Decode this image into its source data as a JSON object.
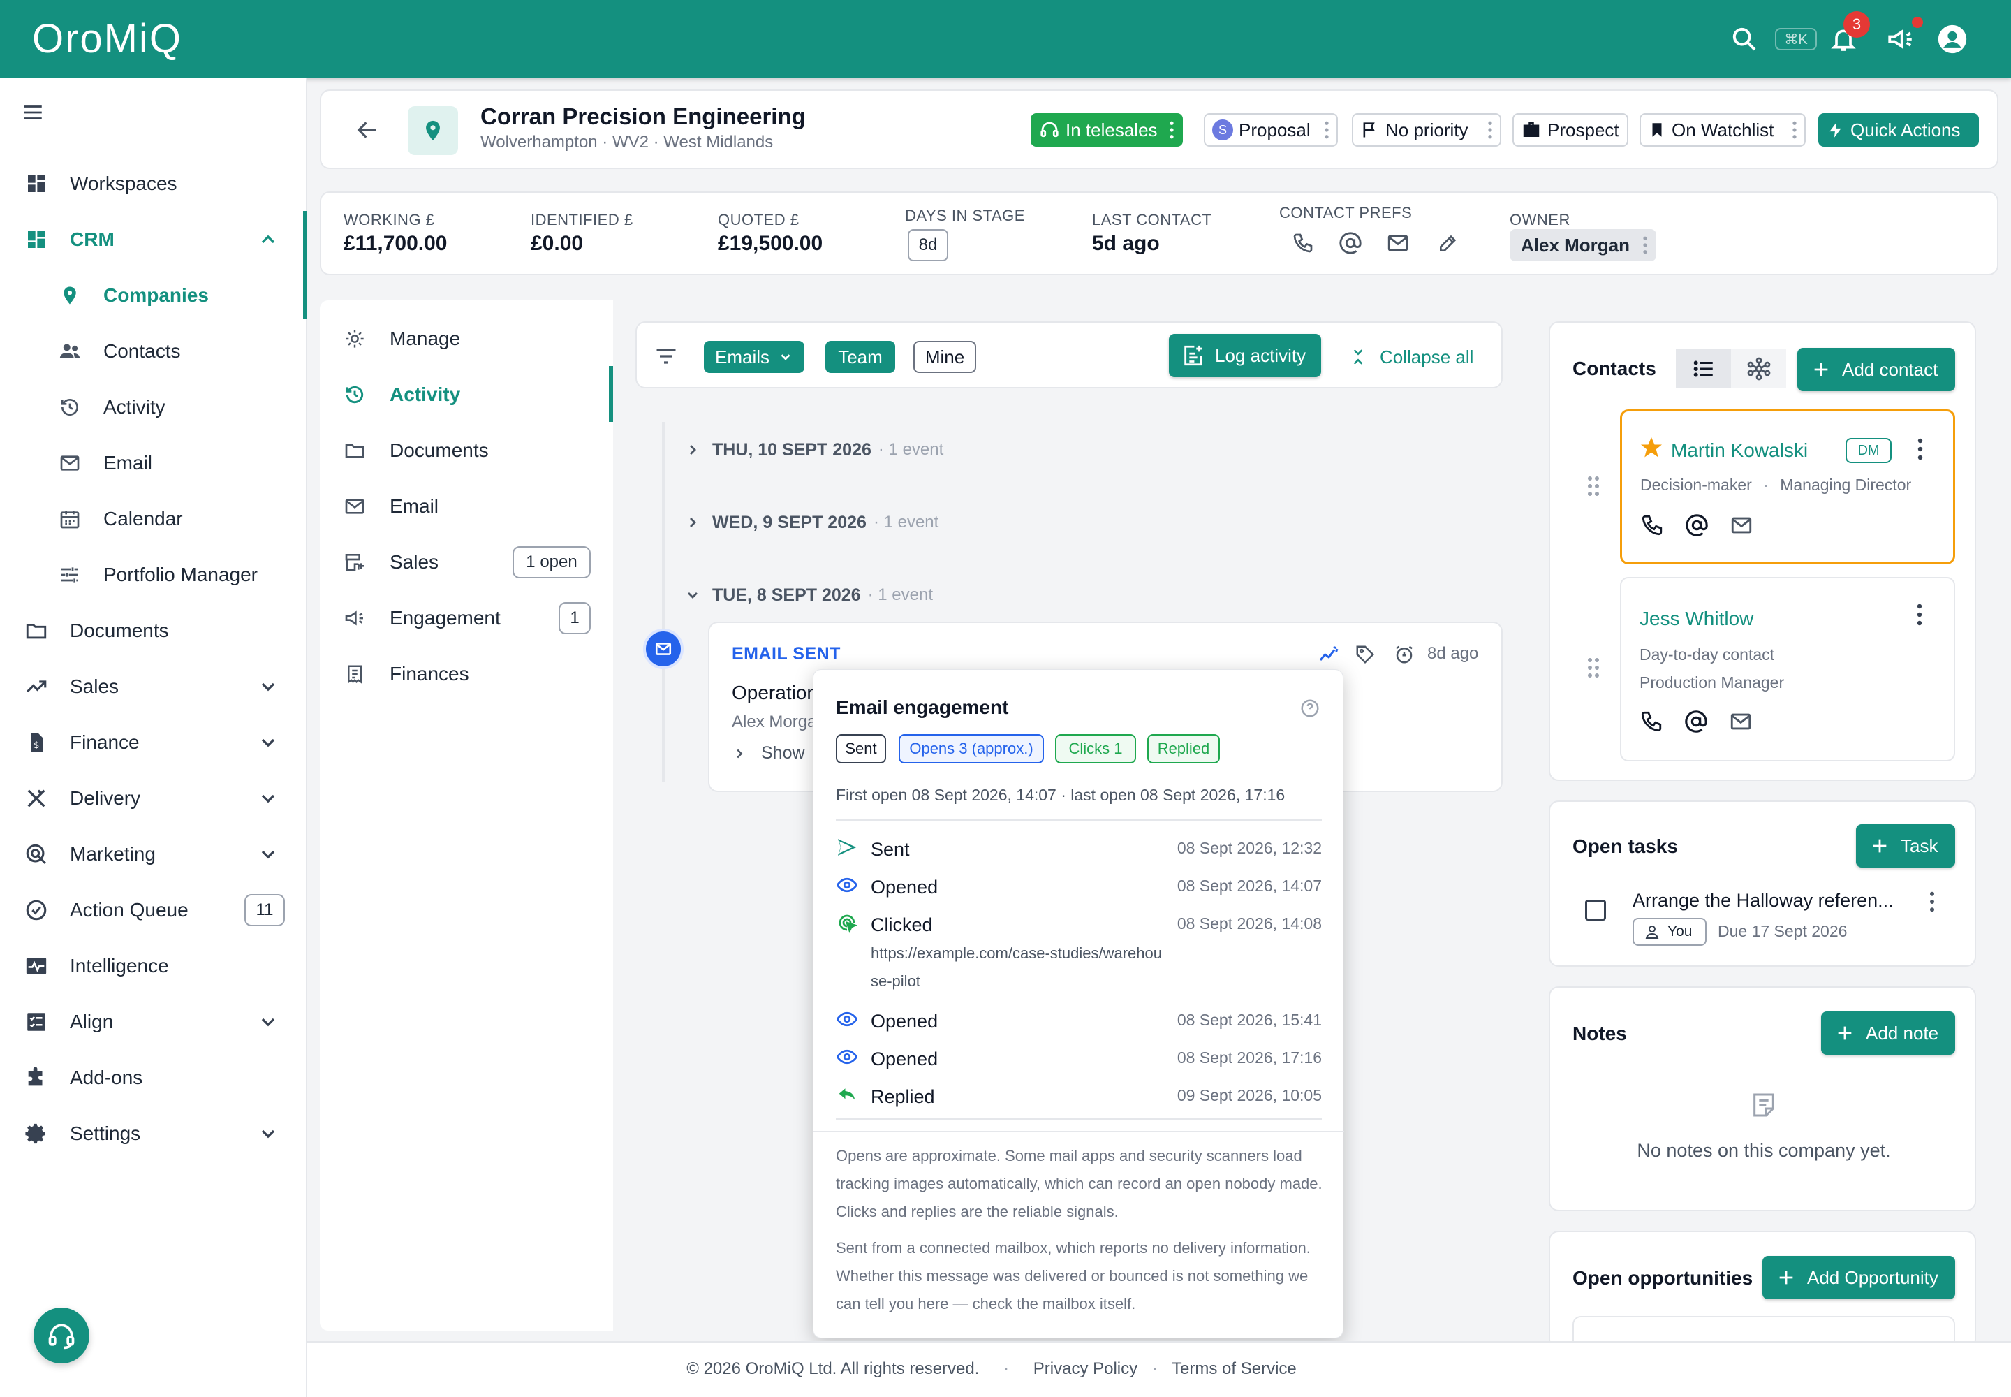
{
  "app": {
    "logo": "OroMiQ",
    "search_shortcut": "⌘K",
    "notification_count": "3"
  },
  "colors": {
    "brand": "#14907f",
    "green": "#1fa84f",
    "blue": "#2563eb",
    "orange": "#f59e0b"
  },
  "sidebar": {
    "items": [
      {
        "label": "Workspaces",
        "icon": "dashboard-icon"
      },
      {
        "label": "CRM",
        "icon": "crm-icon"
      },
      {
        "label": "Companies",
        "icon": "location-pin-icon"
      },
      {
        "label": "Contacts",
        "icon": "people-icon"
      },
      {
        "label": "Activity",
        "icon": "history-icon"
      },
      {
        "label": "Email",
        "icon": "mail-icon"
      },
      {
        "label": "Calendar",
        "icon": "calendar-icon"
      },
      {
        "label": "Portfolio Manager",
        "icon": "sliders-icon"
      },
      {
        "label": "Documents",
        "icon": "folder-icon"
      },
      {
        "label": "Sales",
        "icon": "trending-up-icon"
      },
      {
        "label": "Finance",
        "icon": "invoice-icon"
      },
      {
        "label": "Delivery",
        "icon": "tools-icon"
      },
      {
        "label": "Marketing",
        "icon": "target-icon"
      },
      {
        "label": "Action Queue",
        "icon": "check-circle-icon",
        "badge": "11"
      },
      {
        "label": "Intelligence",
        "icon": "pulse-icon"
      },
      {
        "label": "Align",
        "icon": "checklist-icon"
      },
      {
        "label": "Add-ons",
        "icon": "puzzle-icon"
      },
      {
        "label": "Settings",
        "icon": "gear-icon"
      }
    ]
  },
  "header": {
    "company_name": "Corran Precision Engineering",
    "location": "Wolverhampton · WV2 · West Midlands",
    "telesales": "In telesales",
    "stage_initial": "S",
    "stage": "Proposal",
    "priority": "No priority",
    "type": "Prospect",
    "watchlist": "On Watchlist",
    "quick_actions": "Quick Actions"
  },
  "stats": {
    "working_label": "WORKING £",
    "working_value": "£11,700.00",
    "identified_label": "IDENTIFIED £",
    "identified_value": "£0.00",
    "quoted_label": "QUOTED £",
    "quoted_value": "£19,500.00",
    "days_label": "DAYS IN STAGE",
    "days_value": "8d",
    "last_label": "LAST CONTACT",
    "last_value": "5d ago",
    "prefs_label": "CONTACT PREFS",
    "owner_label": "OWNER",
    "owner_value": "Alex Morgan"
  },
  "tabs": {
    "items": [
      {
        "label": "Manage"
      },
      {
        "label": "Activity"
      },
      {
        "label": "Documents"
      },
      {
        "label": "Email"
      },
      {
        "label": "Sales",
        "badge": "1 open"
      },
      {
        "label": "Engagement",
        "badge": "1"
      },
      {
        "label": "Finances"
      }
    ]
  },
  "filters": {
    "emails": "Emails",
    "team": "Team",
    "mine": "Mine",
    "log_activity": "Log activity",
    "collapse_all": "Collapse all"
  },
  "timeline": {
    "days": [
      {
        "label": "THU, 10 SEPT 2026",
        "count": "· 1 event"
      },
      {
        "label": "WED, 9 SEPT 2026",
        "count": "· 1 event"
      },
      {
        "label": "TUE, 8 SEPT 2026",
        "count": "· 1 event"
      }
    ],
    "email": {
      "title": "EMAIL SENT",
      "subject": "Operation",
      "from": "Alex Morga",
      "show": "Show",
      "ago": "8d ago"
    }
  },
  "engagement": {
    "title": "Email engagement",
    "chips": {
      "sent": "Sent",
      "opens": "Opens 3 (approx.)",
      "clicks": "Clicks 1",
      "replied": "Replied"
    },
    "summary": "First open 08 Sept 2026, 14:07 · last open 08 Sept 2026, 17:16",
    "events": [
      {
        "label": "Sent",
        "time": "08 Sept 2026, 12:32"
      },
      {
        "label": "Opened",
        "time": "08 Sept 2026, 14:07"
      },
      {
        "label": "Clicked",
        "time": "08 Sept 2026, 14:08"
      },
      {
        "label": "Opened",
        "time": "08 Sept 2026, 15:41"
      },
      {
        "label": "Opened",
        "time": "08 Sept 2026, 17:16"
      },
      {
        "label": "Replied",
        "time": "09 Sept 2026, 10:05"
      }
    ],
    "clicked_url": "https://example.com/case-studies/warehouse-pilot",
    "note1": "Opens are approximate. Some mail apps and security scanners load tracking images automatically, which can record an open nobody made. Clicks and replies are the reliable signals.",
    "note2": "Sent from a connected mailbox, which reports no delivery information. Whether this message was delivered or bounced is not something we can tell you here — check the mailbox itself."
  },
  "contacts": {
    "title": "Contacts",
    "add": "Add contact",
    "items": [
      {
        "name": "Martin Kowalski",
        "badge": "DM",
        "role": "Decision-maker",
        "title": "Managing Director"
      },
      {
        "name": "Jess Whitlow",
        "role": "Day-to-day contact",
        "title": "Production Manager"
      }
    ],
    "role_sep": "·"
  },
  "tasks": {
    "title": "Open tasks",
    "add": "Task",
    "item_title": "Arrange the Halloway referen...",
    "assignee": "You",
    "due": "Due 17 Sept 2026"
  },
  "notes": {
    "title": "Notes",
    "add": "Add note",
    "empty": "No notes on this company yet."
  },
  "opportunities": {
    "title": "Open opportunities",
    "add": "Add Opportunity"
  },
  "footer": {
    "copyright": "© 2026 OroMiQ Ltd. All rights reserved.",
    "sep": "·",
    "privacy": "Privacy Policy",
    "terms": "Terms of Service"
  }
}
